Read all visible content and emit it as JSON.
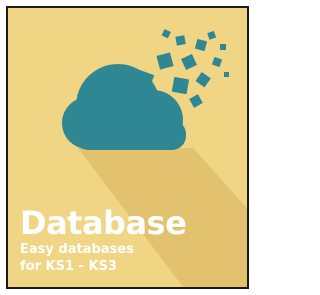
{
  "tile": {
    "title": "Database",
    "subtitle_line1": "Easy databases",
    "subtitle_line2": "for KS1 - KS3",
    "icon": "cloud-data-icon",
    "colors": {
      "background": "#f0d584",
      "shadow": "#e3c26f",
      "icon": "#2f8794",
      "text": "#ffffff",
      "border": "#1b1b1b"
    }
  }
}
